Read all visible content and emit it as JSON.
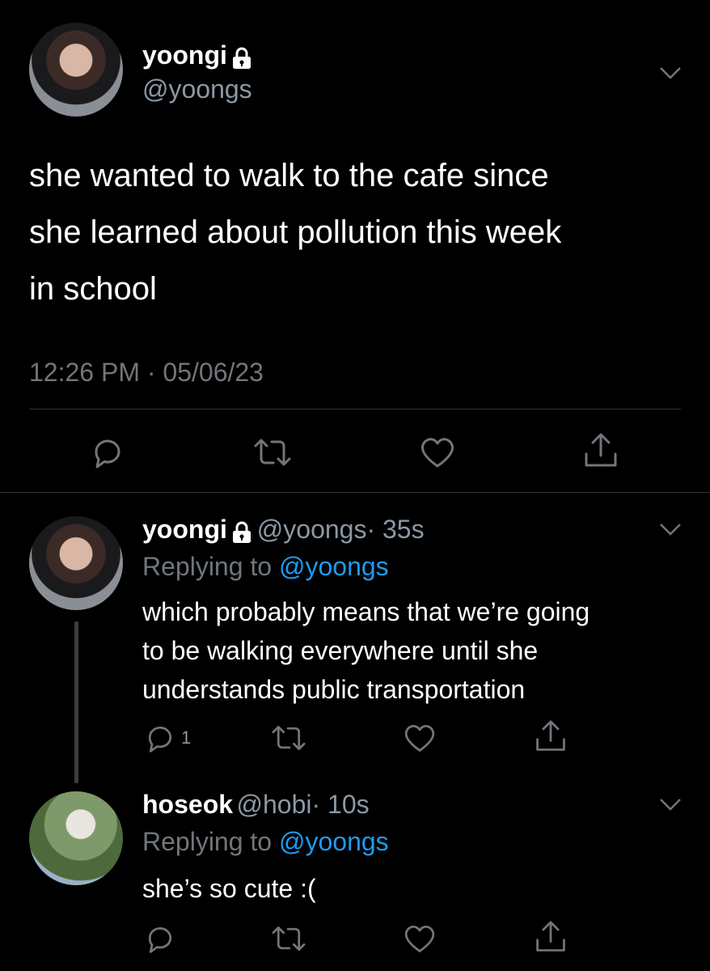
{
  "main_tweet": {
    "display_name": "yoongi",
    "handle": "@yoongs",
    "text_line1": "she wanted to walk to the cafe since",
    "text_line2": "she learned about pollution this week",
    "text_line3": "in school",
    "timestamp": "12:26 PM · 05/06/23"
  },
  "replies": [
    {
      "display_name": "yoongi",
      "handle": "@yoongs",
      "time": "· 35s",
      "replying_prefix": "Replying to",
      "replying_to": "@yoongs",
      "text_line1": "which probably means that we’re going",
      "text_line2": "to be walking everywhere until she",
      "text_line3": "understands public transportation",
      "reply_count": "1"
    },
    {
      "display_name": "hoseok",
      "handle": "@hobi",
      "time": "· 10s",
      "replying_prefix": "Replying to",
      "replying_to": "@yoongs",
      "text_line1": "she’s so cute :("
    }
  ],
  "icons": [
    "lock-icon",
    "chevron-down-icon",
    "reply-icon",
    "retweet-icon",
    "like-icon",
    "share-icon"
  ],
  "colors": {
    "background": "#000000",
    "text": "#ffffff",
    "muted": "#71767b",
    "link": "#1d9bf0",
    "divider": "#2f3336"
  }
}
